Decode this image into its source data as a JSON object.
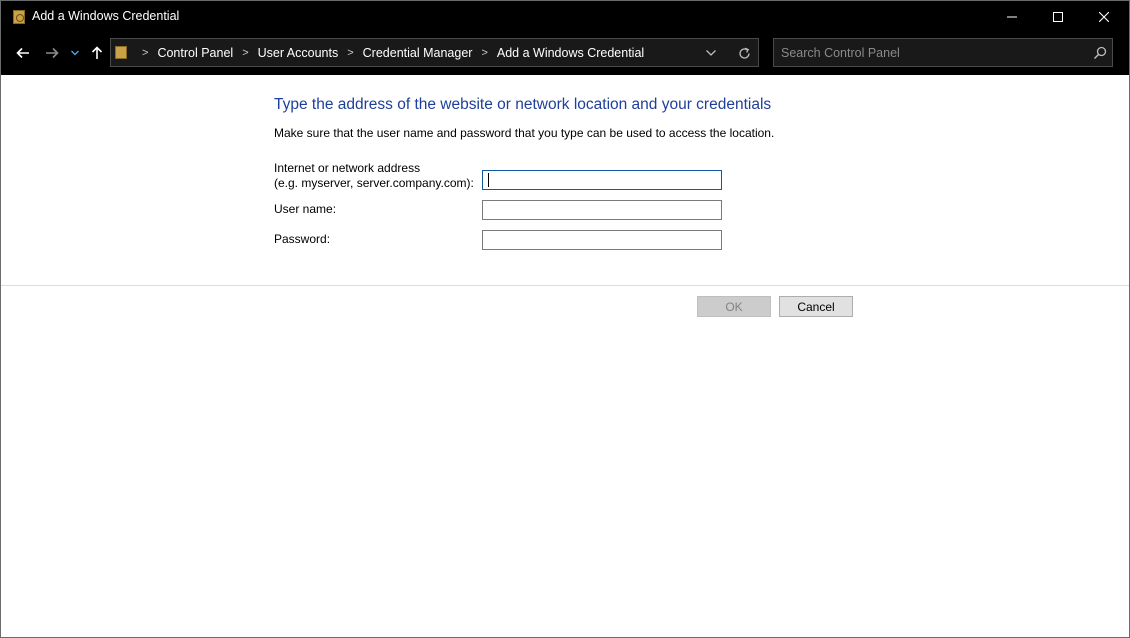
{
  "window": {
    "title": "Add a Windows Credential",
    "controls": {
      "minimize_icon": "minimize-icon",
      "maximize_icon": "maximize-icon",
      "close_icon": "close-icon"
    }
  },
  "navigation": {
    "back_icon": "arrow-left-icon",
    "forward_icon": "arrow-right-icon",
    "recent_icon": "chevron-down-icon",
    "up_icon": "arrow-up-icon",
    "breadcrumbs": [
      "Control Panel",
      "User Accounts",
      "Credential Manager",
      "Add a Windows Credential"
    ],
    "search_placeholder": "Search Control Panel"
  },
  "form": {
    "heading": "Type the address of the website or network location and your credentials",
    "instructions": "Make sure that the user name and password that you type can be used to access the location.",
    "address_label_line1": "Internet or network address",
    "address_label_line2": "(e.g. myserver, server.company.com):",
    "address_value": "",
    "username_label": "User name:",
    "username_value": "",
    "password_label": "Password:",
    "password_value": ""
  },
  "buttons": {
    "ok": "OK",
    "cancel": "Cancel"
  },
  "colors": {
    "titlebar": "#000000",
    "heading": "#1e3f9a",
    "focus_border": "#0c5ba3"
  }
}
